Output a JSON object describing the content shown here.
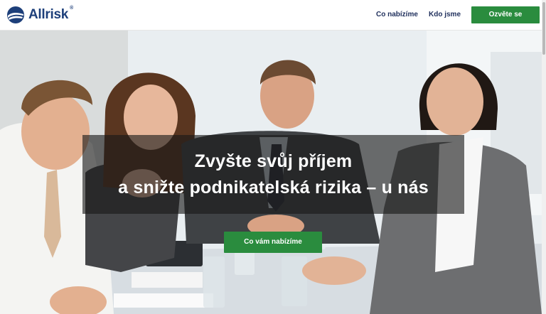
{
  "brand": {
    "name": "Allrisk",
    "registered": "®"
  },
  "nav": {
    "offer": "Co nabízíme",
    "about": "Kdo jsme",
    "cta": "Ozvěte se"
  },
  "hero": {
    "headline_line1": "Zvyšte svůj příjem",
    "headline_line2": "a snižte podnikatelská rizika – u nás",
    "button": "Co vám nabízíme"
  },
  "colors": {
    "brand": "#1d3f7a",
    "accent": "#2a8c3e",
    "nav_text": "#1f2f5c"
  }
}
